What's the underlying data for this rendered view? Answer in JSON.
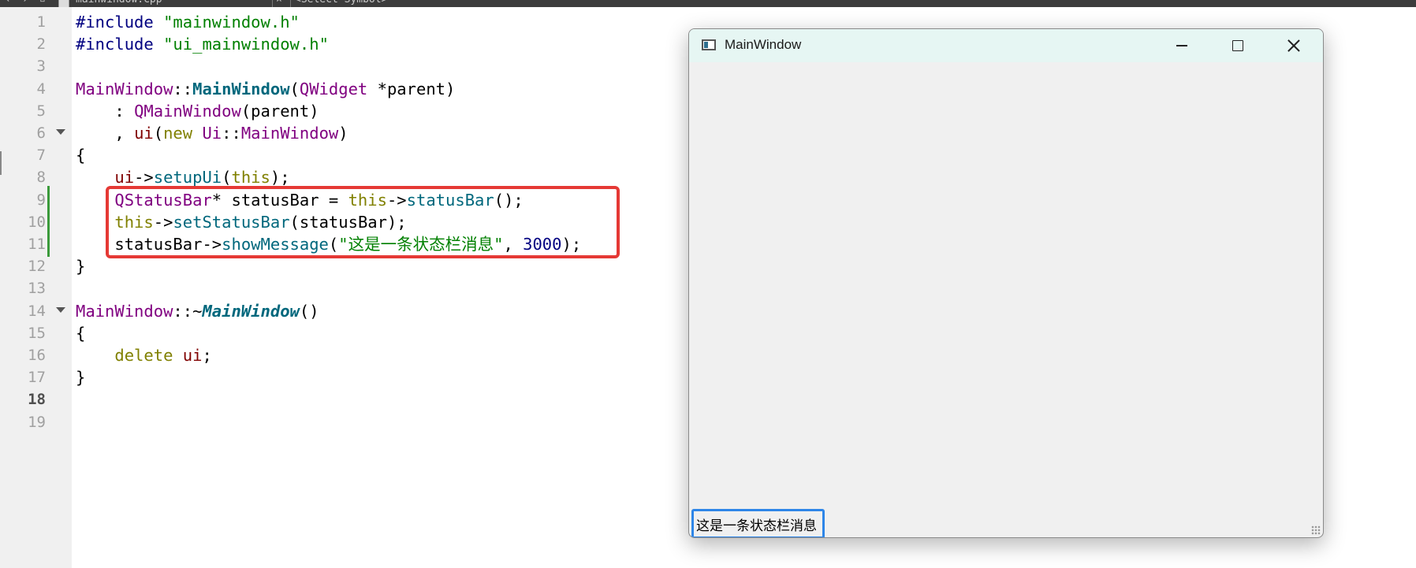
{
  "tabs": {
    "file_name": "mainwindow.cpp",
    "symbol_placeholder": "<Select Symbol>"
  },
  "editor": {
    "current_line": 18,
    "line_numbers": [
      "1",
      "2",
      "3",
      "4",
      "5",
      "6",
      "7",
      "8",
      "9",
      "10",
      "11",
      "12",
      "13",
      "14",
      "15",
      "16",
      "17",
      "18",
      "19"
    ],
    "lines": [
      [
        [
          "pp",
          "#include "
        ],
        [
          "str",
          "\"mainwindow.h\""
        ]
      ],
      [
        [
          "pp",
          "#include "
        ],
        [
          "str",
          "\"ui_mainwindow.h\""
        ]
      ],
      [],
      [
        [
          "ty",
          "MainWindow"
        ],
        [
          "plain",
          "::"
        ],
        [
          "fnb",
          "MainWindow"
        ],
        [
          "plain",
          "("
        ],
        [
          "ty",
          "QWidget"
        ],
        [
          "plain",
          " *"
        ],
        [
          "plain",
          "parent"
        ],
        [
          "plain",
          ")"
        ]
      ],
      [
        [
          "plain",
          "    : "
        ],
        [
          "ty",
          "QMainWindow"
        ],
        [
          "plain",
          "(parent)"
        ]
      ],
      [
        [
          "plain",
          "    , "
        ],
        [
          "mem",
          "ui"
        ],
        [
          "plain",
          "("
        ],
        [
          "kw",
          "new"
        ],
        [
          "plain",
          " "
        ],
        [
          "ty",
          "Ui"
        ],
        [
          "plain",
          "::"
        ],
        [
          "ty",
          "MainWindow"
        ],
        [
          "plain",
          ")"
        ]
      ],
      [
        [
          "plain",
          "{"
        ]
      ],
      [
        [
          "plain",
          "    "
        ],
        [
          "mem",
          "ui"
        ],
        [
          "plain",
          "->"
        ],
        [
          "fn",
          "setupUi"
        ],
        [
          "plain",
          "("
        ],
        [
          "kw",
          "this"
        ],
        [
          "plain",
          ");"
        ]
      ],
      [
        [
          "plain",
          "    "
        ],
        [
          "ty",
          "QStatusBar"
        ],
        [
          "plain",
          "* statusBar = "
        ],
        [
          "kw",
          "this"
        ],
        [
          "plain",
          "->"
        ],
        [
          "fn",
          "statusBar"
        ],
        [
          "plain",
          "();"
        ]
      ],
      [
        [
          "plain",
          "    "
        ],
        [
          "kw",
          "this"
        ],
        [
          "plain",
          "->"
        ],
        [
          "fn",
          "setStatusBar"
        ],
        [
          "plain",
          "(statusBar);"
        ]
      ],
      [
        [
          "plain",
          "    statusBar->"
        ],
        [
          "fn",
          "showMessage"
        ],
        [
          "plain",
          "("
        ],
        [
          "str",
          "\"这是一条状态栏消息\""
        ],
        [
          "plain",
          ", "
        ],
        [
          "num",
          "3000"
        ],
        [
          "plain",
          ");"
        ]
      ],
      [
        [
          "plain",
          "}"
        ]
      ],
      [],
      [
        [
          "ty",
          "MainWindow"
        ],
        [
          "plain",
          "::~"
        ],
        [
          "fnbi",
          "MainWindow"
        ],
        [
          "plain",
          "()"
        ]
      ],
      [
        [
          "plain",
          "{"
        ]
      ],
      [
        [
          "plain",
          "    "
        ],
        [
          "kw",
          "delete"
        ],
        [
          "plain",
          " "
        ],
        [
          "mem",
          "ui"
        ],
        [
          "plain",
          ";"
        ]
      ],
      [
        [
          "plain",
          "}"
        ]
      ],
      [],
      []
    ]
  },
  "window": {
    "title": "MainWindow",
    "status_message": "这是一条状态栏消息",
    "minimize_icon": "minimize-icon",
    "maximize_icon": "maximize-icon",
    "close_icon": "close-icon"
  },
  "colors": {
    "highlight_box": "#e53935",
    "status_box": "#2e86e8",
    "title_bar": "#e6f6f3"
  }
}
